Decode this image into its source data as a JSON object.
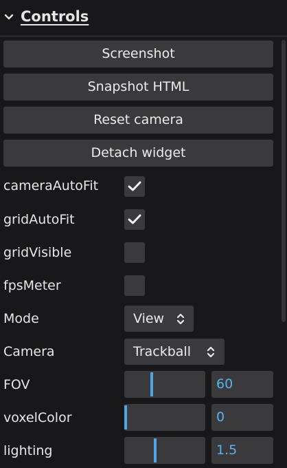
{
  "header": {
    "title": "Controls"
  },
  "buttons": {
    "screenshot": "Screenshot",
    "snapshot_html": "Snapshot HTML",
    "reset_camera": "Reset camera",
    "detach_widget": "Detach widget"
  },
  "toggles": [
    {
      "label": "cameraAutoFit",
      "checked": true
    },
    {
      "label": "gridAutoFit",
      "checked": true
    },
    {
      "label": "gridVisible",
      "checked": false
    },
    {
      "label": "fpsMeter",
      "checked": false
    }
  ],
  "selects": {
    "mode": {
      "label": "Mode",
      "value": "View"
    },
    "camera": {
      "label": "Camera",
      "value": "Trackball"
    }
  },
  "sliders": {
    "fov": {
      "label": "FOV",
      "value": "60",
      "fraction": 0.33
    },
    "voxel_color": {
      "label": "voxelColor",
      "value": "0",
      "fraction": 0.0
    },
    "lighting": {
      "label": "lighting",
      "value": "1.5",
      "fraction": 0.38
    }
  },
  "colors": {
    "accent": "#4ba7e6",
    "value_text": "#58b1f0",
    "control_bg": "#3a3a3c",
    "panel_bg": "#18181a"
  }
}
